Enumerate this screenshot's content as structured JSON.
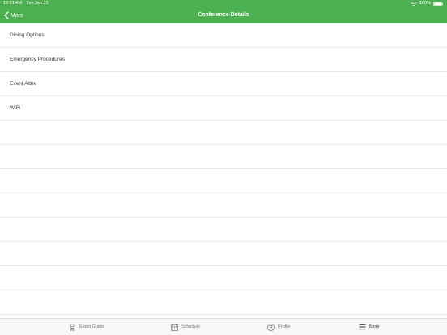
{
  "status_bar": {
    "time": "12:21 AM",
    "date": "Tue Jan 31",
    "battery": "100%"
  },
  "nav": {
    "back_label": "More",
    "title": "Conference Details"
  },
  "list": {
    "items": [
      {
        "label": "Dining Options"
      },
      {
        "label": "Emergency Procedures"
      },
      {
        "label": "Event Attire"
      },
      {
        "label": "WiFi"
      }
    ]
  },
  "tab_bar": {
    "tabs": [
      {
        "label": "Event Guide",
        "icon": "event-guide-icon"
      },
      {
        "label": "Schedule",
        "icon": "calendar-icon"
      },
      {
        "label": "Profile",
        "icon": "profile-icon"
      },
      {
        "label": "More",
        "icon": "menu-icon"
      }
    ],
    "active": "More"
  },
  "colors": {
    "header_green": "#4caf50",
    "tab_bar_bg": "#f7f7f7"
  }
}
